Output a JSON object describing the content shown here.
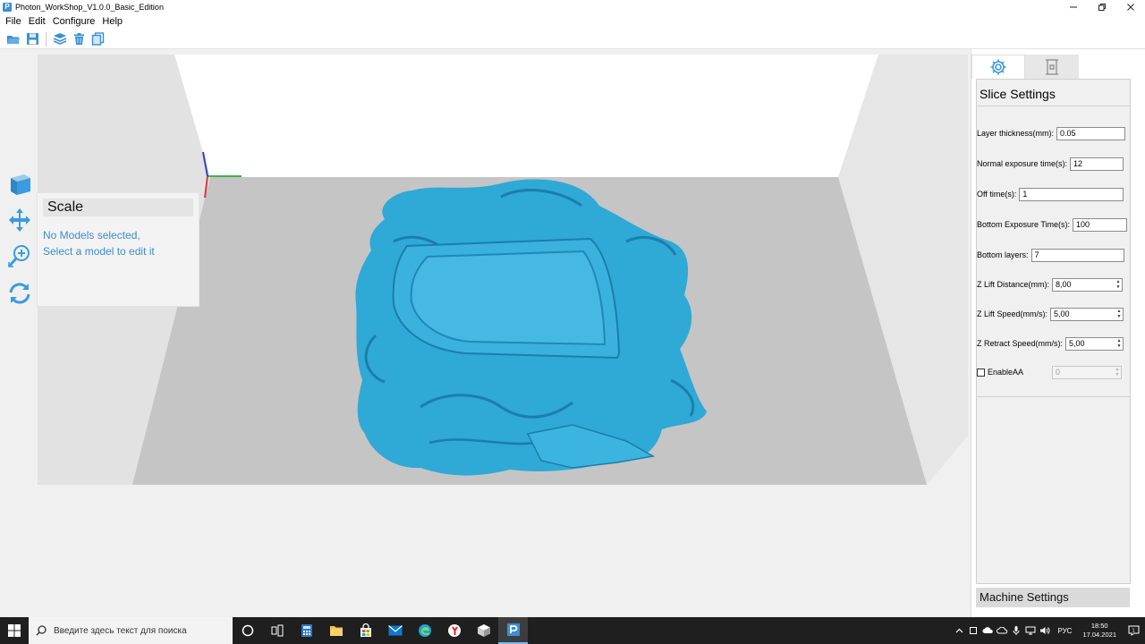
{
  "window": {
    "title": "Photon_WorkShop_V1.0.0_Basic_Edition",
    "app_icon_letter": "P"
  },
  "menu": [
    "File",
    "Edit",
    "Configure",
    "Help"
  ],
  "scale_panel": {
    "title": "Scale",
    "message_line1": "No Models selected,",
    "message_line2": "Select a model to edit it"
  },
  "slice_settings": {
    "title": "Slice Settings",
    "layer_thickness_label": "Layer thickness(mm):",
    "layer_thickness_value": "0.05",
    "normal_exposure_label": "Normal exposure time(s):",
    "normal_exposure_value": "12",
    "off_time_label": "Off time(s):",
    "off_time_value": "1",
    "bottom_exposure_label": "Bottom Exposure Time(s):",
    "bottom_exposure_value": "100",
    "bottom_layers_label": "Bottom layers:",
    "bottom_layers_value": "7",
    "z_lift_distance_label": "Z Lift Distance(mm):",
    "z_lift_distance_value": "8,00",
    "z_lift_speed_label": "Z Lift Speed(mm/s):",
    "z_lift_speed_value": "5,00",
    "z_retract_speed_label": "Z Retract Speed(mm/s):",
    "z_retract_speed_value": "5,00",
    "enable_aa_label": "EnableAA",
    "enable_aa_checked": false,
    "aa_level_value": "0"
  },
  "machine_settings_label": "Machine Settings",
  "taskbar": {
    "search_placeholder": "Введите здесь текст для поиска",
    "language": "РУС",
    "time": "18:50",
    "date": "17.04.2021"
  },
  "colors": {
    "model": "#2fa9d6",
    "accent": "#3a8ec9",
    "build_plate": "#c5c5c5"
  }
}
